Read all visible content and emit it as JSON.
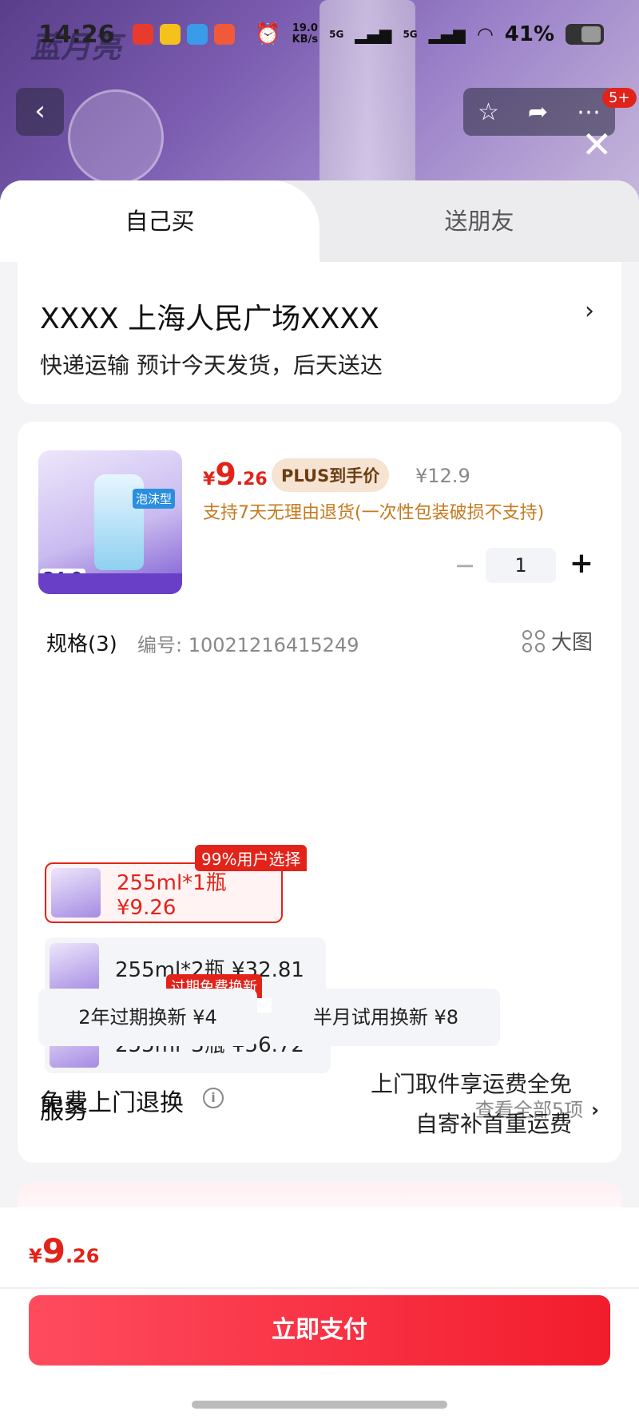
{
  "status_bar": {
    "time": "14:26",
    "speed_value": "19.0",
    "speed_unit": "KB/s",
    "net1": "5G",
    "net2": "5G",
    "battery": "41%"
  },
  "backdrop": {
    "logo": "蓝月亮"
  },
  "header": {
    "badge": "5+"
  },
  "tabs": [
    {
      "label": "自己买"
    },
    {
      "label": "送朋友"
    }
  ],
  "address": {
    "line": "XXXX  上海人民广场XXXX",
    "shipping": "快递运输 预计今天发货，后天送达"
  },
  "product": {
    "image_tag": "泡沫型",
    "image_price": "24.9",
    "price_currency": "¥",
    "price_int": "9",
    "price_dec": ".26",
    "plus_label": "PLUS到手价",
    "original_price": "¥12.9",
    "return_note": "支持7天无理由退货(一次性包装破损不支持)",
    "quantity": "1",
    "minus": "−",
    "plus": "+"
  },
  "spec": {
    "title": "规格(3)",
    "code": "编号: 10021216415249",
    "big_image": "大图",
    "hot_badge": "99%用户选择",
    "options": [
      {
        "label": "255ml*1瓶  ¥9.26",
        "selected": true
      },
      {
        "label": "255ml*2瓶  ¥32.81",
        "selected": false
      },
      {
        "label": "255ml*3瓶  ¥56.72",
        "selected": false
      }
    ]
  },
  "service": {
    "title": "服务",
    "view_all": "查看全部5项",
    "badge": "过期免费换新",
    "chips": [
      {
        "label": "2年过期换新  ¥4"
      },
      {
        "label": "半月试用换新  ¥8"
      }
    ],
    "return_title": "免费上门退换",
    "return_desc1": "上门取件享运费全免",
    "return_desc2": "自寄补首重运费"
  },
  "footer": {
    "price_currency": "¥",
    "price_int": "9",
    "price_dec": ".26",
    "pay_label": "立即支付"
  },
  "colors": {
    "accent_red": "#e2231a",
    "plus_gold": "#c57a1e",
    "pay_gradient_start": "#ff4b5f",
    "pay_gradient_end": "#f21c2c"
  }
}
